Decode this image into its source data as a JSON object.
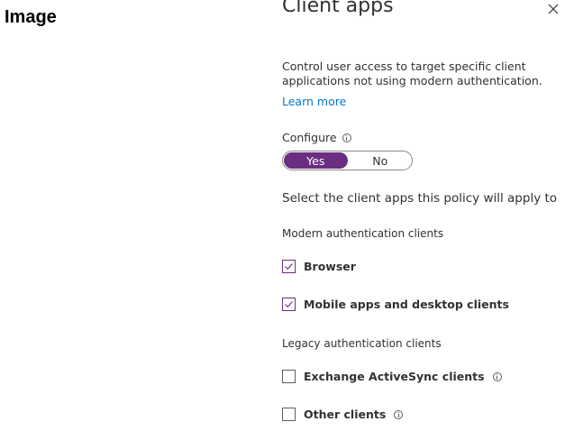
{
  "corner_label": "Image",
  "panel": {
    "title": "Client apps",
    "description_lines": [
      "Control user access to target specific client",
      "applications not using modern authentication."
    ],
    "learn_more": "Learn more",
    "configure_label": "Configure",
    "toggle": {
      "yes": "Yes",
      "no": "No",
      "selected": "Yes"
    },
    "select_prompt": "Select the client apps this policy will apply to",
    "modern_section": "Modern authentication clients",
    "modern_options": [
      {
        "label": "Browser",
        "checked": true
      },
      {
        "label": "Mobile apps and desktop clients",
        "checked": true
      }
    ],
    "legacy_section": "Legacy authentication clients",
    "legacy_options": [
      {
        "label": "Exchange ActiveSync clients",
        "checked": false,
        "info": true
      },
      {
        "label": "Other clients",
        "checked": false,
        "info": true
      }
    ]
  },
  "colors": {
    "accent": "#6b2d82",
    "link": "#0078d4",
    "text": "#323130"
  },
  "icons": [
    "close-icon",
    "info-icon",
    "checkmark-icon"
  ]
}
